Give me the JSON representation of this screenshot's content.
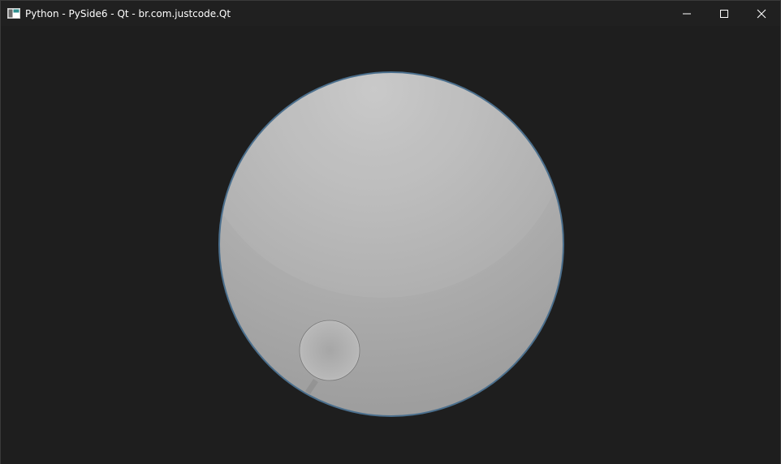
{
  "window": {
    "title": "Python - PySide6 - Qt - br.com.justcode.Qt",
    "icon": "app-window-icon",
    "controls": {
      "minimize_icon": "minimize-icon",
      "maximize_icon": "maximize-icon",
      "close_icon": "close-icon"
    }
  },
  "dial": {
    "value_fraction": 0.0,
    "notch_icon": "dial-notch",
    "colors": {
      "face_light": "#c4c4c4",
      "face_dark": "#9a9a9a",
      "rim": "#4a6f8c",
      "background": "#1e1e1e"
    }
  }
}
